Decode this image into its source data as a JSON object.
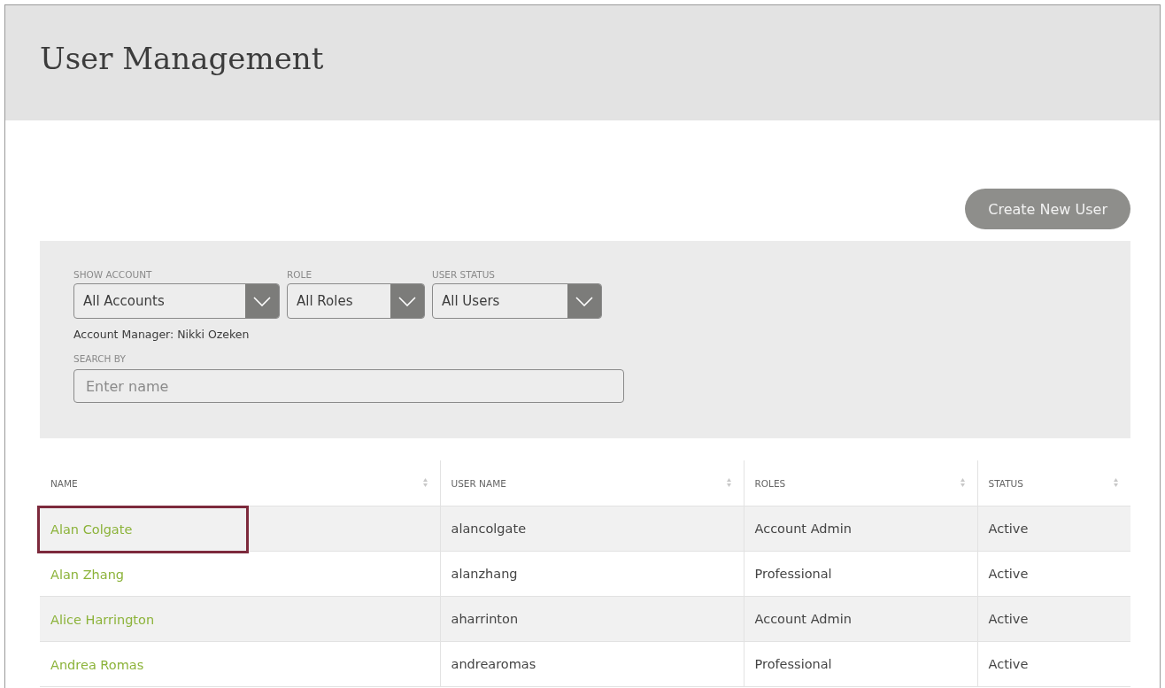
{
  "page_title": "User Management",
  "create_button": "Create New User",
  "filters": [
    {
      "label": "SHOW ACCOUNT",
      "value": "All Accounts"
    },
    {
      "label": "ROLE",
      "value": "All Roles"
    },
    {
      "label": "USER STATUS",
      "value": "All Users"
    }
  ],
  "account_manager": "Account Manager: Nikki Ozeken",
  "search": {
    "label": "SEARCH BY",
    "placeholder": "Enter name"
  },
  "table": {
    "columns": [
      "NAME",
      "USER NAME",
      "ROLES",
      "STATUS"
    ],
    "rows": [
      {
        "name": "Alan Colgate",
        "user_name": "alancolgate",
        "roles": "Account Admin",
        "status": "Active",
        "highlighted": true
      },
      {
        "name": "Alan Zhang",
        "user_name": "alanzhang",
        "roles": "Professional",
        "status": "Active",
        "highlighted": false
      },
      {
        "name": "Alice Harrington",
        "user_name": "aharrinton",
        "roles": "Account Admin",
        "status": "Active",
        "highlighted": false
      },
      {
        "name": "Andrea Romas",
        "user_name": "andrearomas",
        "roles": "Professional",
        "status": "Active",
        "highlighted": false
      }
    ]
  }
}
